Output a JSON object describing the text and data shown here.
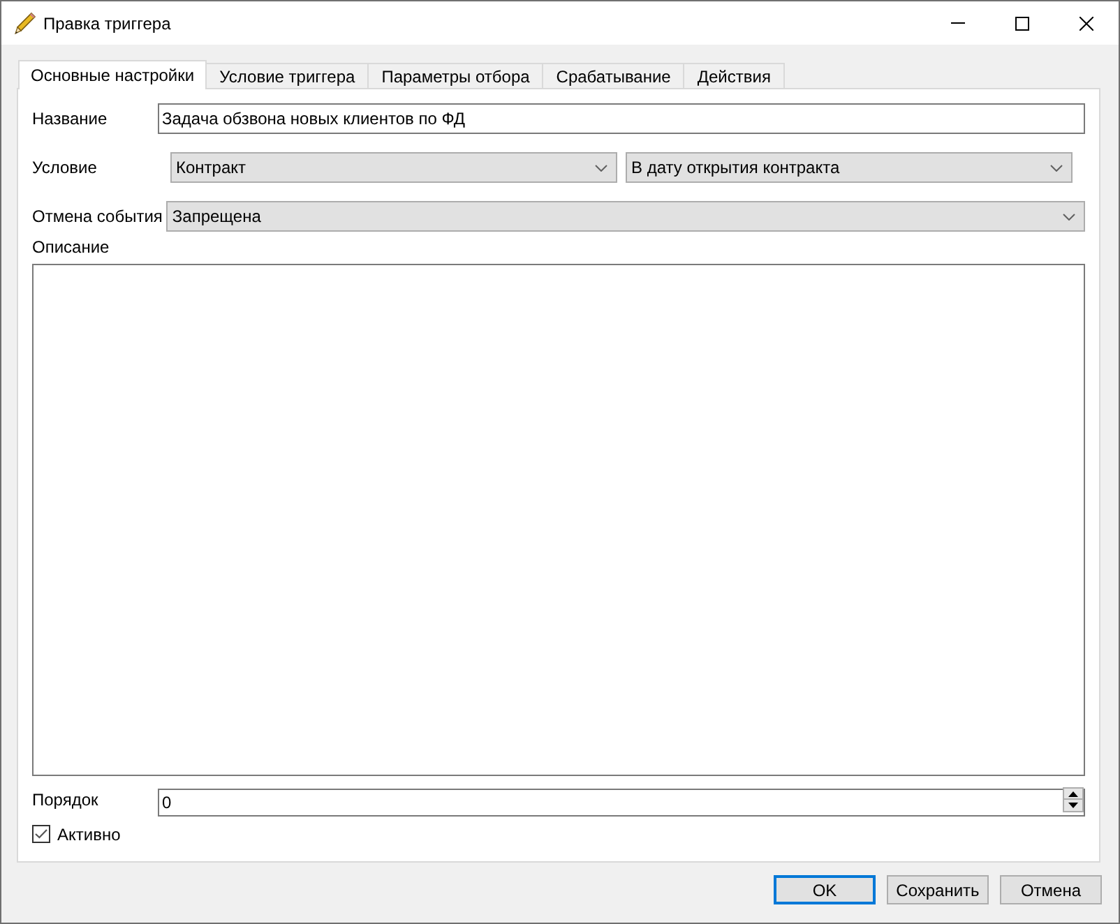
{
  "window": {
    "title": "Правка триггера"
  },
  "tabs": [
    {
      "label": "Основные настройки",
      "selected": true
    },
    {
      "label": "Условие триггера",
      "selected": false
    },
    {
      "label": "Параметры отбора",
      "selected": false
    },
    {
      "label": "Срабатывание",
      "selected": false
    },
    {
      "label": "Действия",
      "selected": false
    }
  ],
  "form": {
    "name": {
      "label": "Название",
      "value": "Задача обзвона новых клиентов по ФД"
    },
    "condition": {
      "label": "Условие",
      "dropdowns": [
        "Контракт",
        "В дату открытия контракта"
      ]
    },
    "cancel_event": {
      "label": "Отмена события",
      "value": "Запрещена"
    },
    "description": {
      "label": "Описание"
    },
    "order": {
      "label": "Порядок",
      "value": "0"
    },
    "active": {
      "label": "Активно",
      "checked": true
    }
  },
  "buttons": [
    {
      "label": "OK",
      "default": true
    },
    {
      "label": "Сохранить",
      "default": false
    },
    {
      "label": "Отмена",
      "default": false
    }
  ]
}
